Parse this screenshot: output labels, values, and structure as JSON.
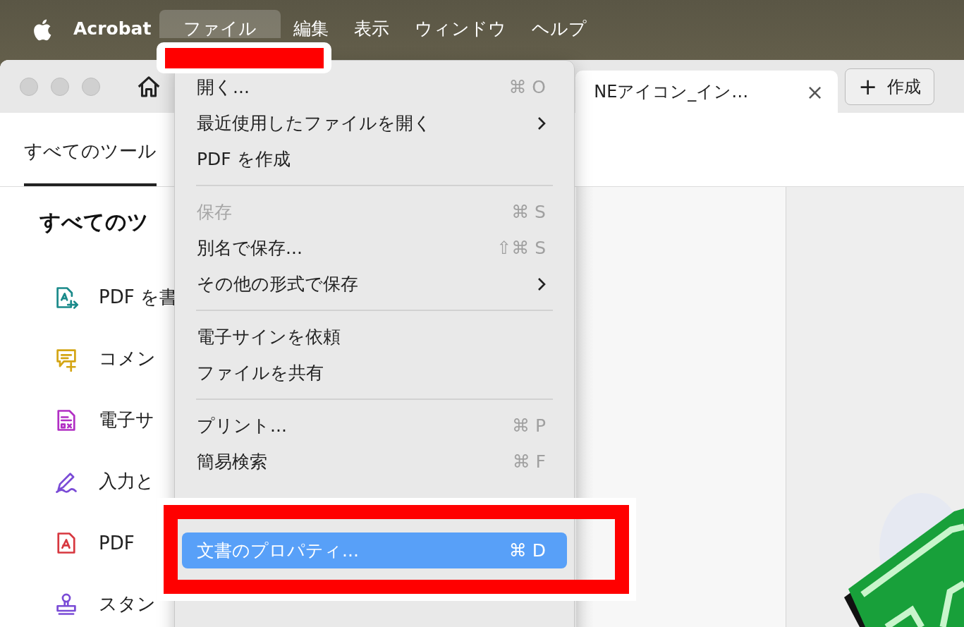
{
  "menubar": {
    "app": "Acrobat",
    "menus": [
      {
        "label": "ファイル",
        "selected": true
      },
      {
        "label": "編集",
        "selected": false
      },
      {
        "label": "表示",
        "selected": false
      },
      {
        "label": "ウィンドウ",
        "selected": false
      },
      {
        "label": "ヘルプ",
        "selected": false
      }
    ]
  },
  "tabbar": {
    "tab": {
      "title": "NEアイコン_イン…",
      "close": "×"
    },
    "create_button": {
      "icon": "+",
      "label": "作成"
    }
  },
  "toolbar": {
    "tabs": [
      {
        "label": "すべてのツール",
        "selected": true
      }
    ]
  },
  "tools_panel": {
    "heading": "すべてのツ",
    "items": [
      {
        "label": "PDF を書",
        "color": "#1a8a8a"
      },
      {
        "label": "コメン",
        "color": "#d4a514"
      },
      {
        "label": "電子サ",
        "color": "#b12fc4"
      },
      {
        "label": "入力と",
        "color": "#7a4bd6"
      },
      {
        "label": "PDF",
        "color": "#d7373f"
      },
      {
        "label": "スタン",
        "color": "#7a4bd6"
      }
    ]
  },
  "file_menu": {
    "items": [
      {
        "kind": "item",
        "label": "開く...",
        "shortcut": "⌘ O",
        "submenu": false,
        "disabled": false,
        "selected": false
      },
      {
        "kind": "item",
        "label": "最近使用したファイルを開く",
        "submenu": true,
        "disabled": false,
        "selected": false
      },
      {
        "kind": "item",
        "label": "PDF を作成",
        "submenu": false,
        "disabled": false,
        "selected": false
      },
      {
        "kind": "separator"
      },
      {
        "kind": "item",
        "label": "保存",
        "shortcut": "⌘ S",
        "submenu": false,
        "disabled": true,
        "selected": false
      },
      {
        "kind": "item",
        "label": "別名で保存...",
        "shortcut": "⇧⌘ S",
        "submenu": false,
        "disabled": false,
        "selected": false
      },
      {
        "kind": "item",
        "label": "その他の形式で保存",
        "submenu": true,
        "disabled": false,
        "selected": false
      },
      {
        "kind": "separator"
      },
      {
        "kind": "item",
        "label": "電子サインを依頼",
        "submenu": false,
        "disabled": false,
        "selected": false
      },
      {
        "kind": "item",
        "label": "ファイルを共有",
        "submenu": false,
        "disabled": false,
        "selected": false
      },
      {
        "kind": "separator"
      },
      {
        "kind": "item",
        "label": "プリント...",
        "shortcut": "⌘ P",
        "submenu": false,
        "disabled": false,
        "selected": false
      },
      {
        "kind": "item",
        "label": "簡易検索",
        "shortcut": "⌘ F",
        "submenu": false,
        "disabled": false,
        "selected": false
      },
      {
        "kind": "item",
        "label": "文書のプロパティ...",
        "shortcut": "⌘ D",
        "submenu": false,
        "disabled": false,
        "selected": true
      }
    ]
  }
}
